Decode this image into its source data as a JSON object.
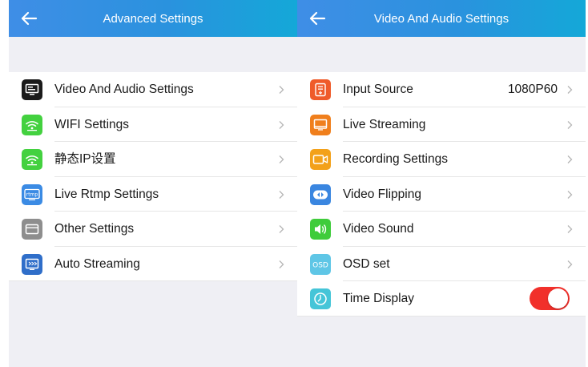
{
  "colors": {
    "appbar_start": "#3f8ee6",
    "appbar_end": "#14a8d8",
    "toggle_on": "#f1302b",
    "background": "#efeff4"
  },
  "left_screen": {
    "title": "Advanced Settings",
    "items": [
      {
        "label": "Video And Audio Settings",
        "icon": "monitor-icon",
        "color": "#1b1b1b"
      },
      {
        "label": "WIFI Settings",
        "icon": "wifi-icon",
        "color": "#43d13f"
      },
      {
        "label": "静态IP设置",
        "icon": "wifi-icon",
        "color": "#43d13f"
      },
      {
        "label": "Live Rtmp Settings",
        "icon": "rtmp-icon",
        "color": "#3b8be4"
      },
      {
        "label": "Other Settings",
        "icon": "window-icon",
        "color": "#8e8e8e"
      },
      {
        "label": "Auto Streaming",
        "icon": "auto-streaming-icon",
        "color": "#2f6ec9"
      }
    ]
  },
  "right_screen": {
    "title": "Video And Audio Settings",
    "items": [
      {
        "label": "Input Source",
        "value": "1080P60",
        "icon": "input-source-icon",
        "color": "#ef5b2a"
      },
      {
        "label": "Live Streaming",
        "icon": "display-icon",
        "color": "#f07f1c"
      },
      {
        "label": "Recording Settings",
        "icon": "camera-icon",
        "color": "#f3a11a"
      },
      {
        "label": "Video Flipping",
        "icon": "flip-icon",
        "color": "#3a86e0"
      },
      {
        "label": "Video Sound",
        "icon": "speaker-icon",
        "color": "#3fcc3b"
      },
      {
        "label": "OSD set",
        "icon": "osd-icon",
        "color": "#5fc6e6",
        "icon_text": "OSD"
      },
      {
        "label": "Time Display",
        "icon": "clock-icon",
        "color": "#45c5d8",
        "toggle_on": true
      }
    ]
  }
}
